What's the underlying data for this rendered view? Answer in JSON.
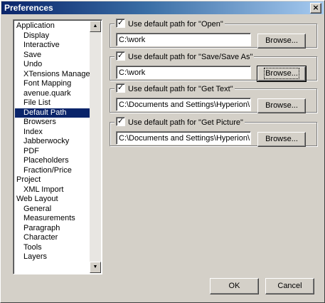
{
  "window": {
    "title": "Preferences",
    "close_glyph": "×"
  },
  "tree": {
    "items": [
      {
        "label": "Application",
        "level": 0
      },
      {
        "label": "Display",
        "level": 1
      },
      {
        "label": "Interactive",
        "level": 1
      },
      {
        "label": "Save",
        "level": 1
      },
      {
        "label": "Undo",
        "level": 1
      },
      {
        "label": "XTensions Manager",
        "level": 1
      },
      {
        "label": "Font Mapping",
        "level": 1
      },
      {
        "label": "avenue.quark",
        "level": 1
      },
      {
        "label": "File List",
        "level": 1
      },
      {
        "label": "Default Path",
        "level": 1,
        "selected": true
      },
      {
        "label": "Browsers",
        "level": 1
      },
      {
        "label": "Index",
        "level": 1
      },
      {
        "label": "Jabberwocky",
        "level": 1
      },
      {
        "label": "PDF",
        "level": 1
      },
      {
        "label": "Placeholders",
        "level": 1
      },
      {
        "label": "Fraction/Price",
        "level": 1
      },
      {
        "label": "Project",
        "level": 0
      },
      {
        "label": "XML Import",
        "level": 1
      },
      {
        "label": "Web Layout",
        "level": 0
      },
      {
        "label": "General",
        "level": 1
      },
      {
        "label": "Measurements",
        "level": 1
      },
      {
        "label": "Paragraph",
        "level": 1
      },
      {
        "label": "Character",
        "level": 1
      },
      {
        "label": "Tools",
        "level": 1
      },
      {
        "label": "Layers",
        "level": 1
      }
    ],
    "scroll_up_glyph": "▲",
    "scroll_down_glyph": "▼"
  },
  "paths": {
    "open": {
      "label": "Use default path for \"Open\"",
      "checked": true,
      "value": "C:\\work",
      "browse": "Browse..."
    },
    "save": {
      "label": "Use default path for \"Save/Save As\"",
      "checked": true,
      "value": "C:\\work",
      "browse": "Browse..."
    },
    "gettext": {
      "label": "Use default path for \"Get Text\"",
      "checked": true,
      "value": "C:\\Documents and Settings\\Hyperion\\Mon",
      "browse": "Browse..."
    },
    "getpic": {
      "label": "Use default path for \"Get Picture\"",
      "checked": true,
      "value": "C:\\Documents and Settings\\Hyperion\\Mon",
      "browse": "Browse..."
    }
  },
  "check_glyph": "✓",
  "buttons": {
    "ok": "OK",
    "cancel": "Cancel"
  }
}
